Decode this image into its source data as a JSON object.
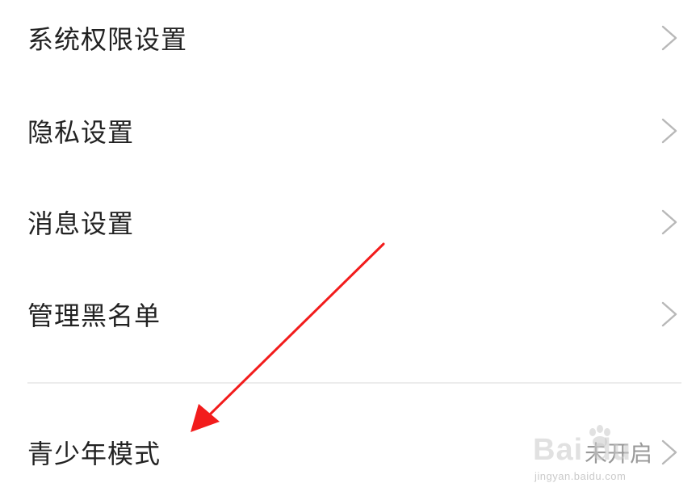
{
  "settings": {
    "items": [
      {
        "label": "系统权限设置"
      },
      {
        "label": "隐私设置"
      },
      {
        "label": "消息设置"
      },
      {
        "label": "管理黑名单"
      }
    ],
    "youth_mode": {
      "label": "青少年模式",
      "value": "未开启"
    }
  },
  "watermark": {
    "brand": "Bai du",
    "url": "jingyan.baidu.com"
  },
  "colors": {
    "text": "#222222",
    "secondary_text": "#999999",
    "chevron": "#b8b8b8",
    "divider": "#ececec",
    "annotation_arrow": "#f21c1c"
  },
  "icons": {
    "row_chevron": "chevron-right-icon",
    "annotation": "red-arrow-annotation",
    "watermark_logo": "baidu-paw-icon"
  }
}
